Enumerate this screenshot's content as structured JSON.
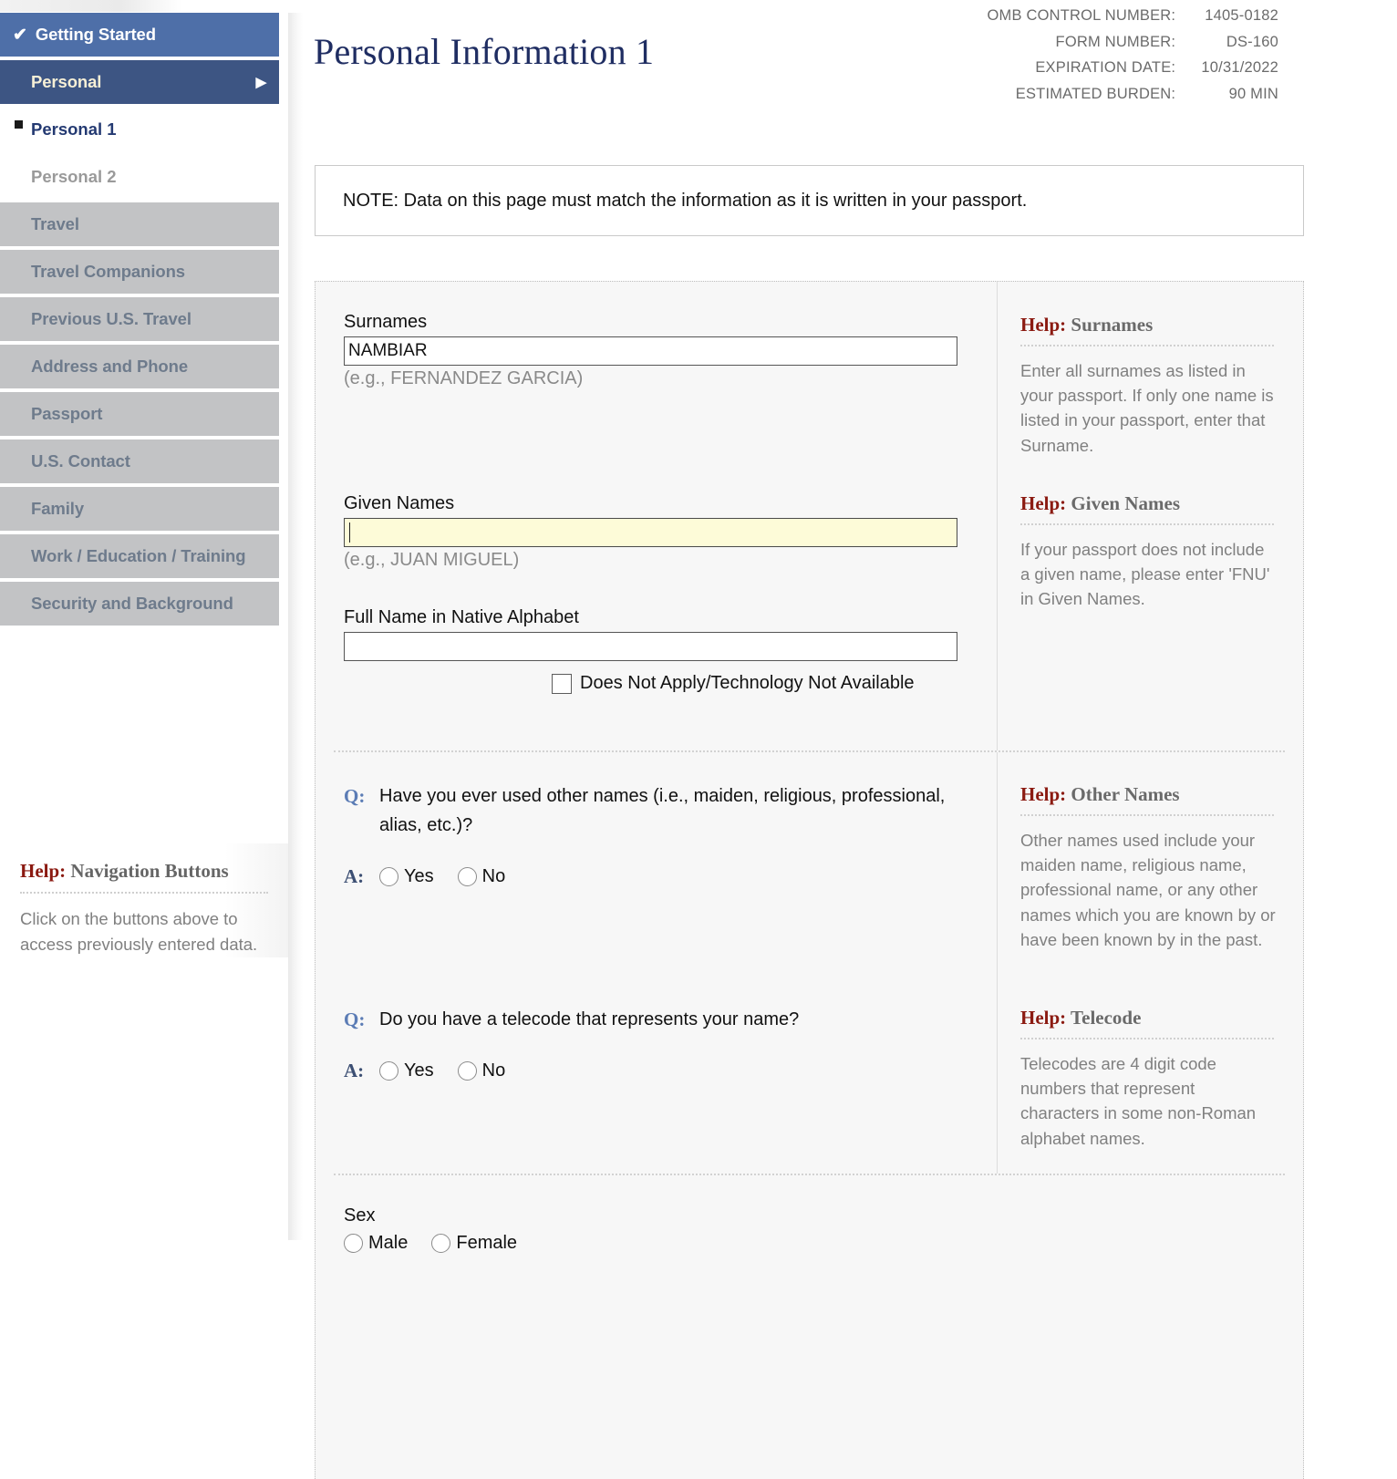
{
  "meta": {
    "rows": [
      {
        "label": "OMB CONTROL NUMBER:",
        "value": "1405-0182"
      },
      {
        "label": "FORM NUMBER:",
        "value": "DS-160"
      },
      {
        "label": "EXPIRATION DATE:",
        "value": "10/31/2022"
      },
      {
        "label": "ESTIMATED BURDEN:",
        "value": "90 MIN"
      }
    ]
  },
  "sidebar": {
    "items": [
      {
        "label": "Getting Started",
        "state": "done",
        "icon": "check-icon"
      },
      {
        "label": "Personal",
        "state": "current",
        "icon": "arrow-right-icon"
      },
      {
        "label": "Personal 1",
        "state": "sub-active",
        "icon": "square-bullet-icon"
      },
      {
        "label": "Personal 2",
        "state": "sub"
      },
      {
        "label": "Travel",
        "state": "normal"
      },
      {
        "label": "Travel Companions",
        "state": "normal"
      },
      {
        "label": "Previous U.S. Travel",
        "state": "normal"
      },
      {
        "label": "Address and Phone",
        "state": "normal"
      },
      {
        "label": "Passport",
        "state": "normal"
      },
      {
        "label": "U.S. Contact",
        "state": "normal"
      },
      {
        "label": "Family",
        "state": "normal"
      },
      {
        "label": "Work / Education / Training",
        "state": "normal"
      },
      {
        "label": "Security and Background",
        "state": "normal"
      }
    ],
    "help": {
      "word": "Help:",
      "title": "Navigation Buttons",
      "body": "Click on the buttons above to access previously entered data."
    }
  },
  "page": {
    "title": "Personal Information 1",
    "note": "NOTE: Data on this page must match the information as it is written in your passport."
  },
  "form": {
    "surnames": {
      "label": "Surnames",
      "value": "NAMBIAR",
      "hint": "(e.g., FERNANDEZ GARCIA)"
    },
    "given_names": {
      "label": "Given Names",
      "value": "",
      "hint": "(e.g., JUAN MIGUEL)"
    },
    "native_alphabet": {
      "label": "Full Name in Native Alphabet",
      "value": "",
      "checkbox_label": "Does Not Apply/Technology Not Available",
      "checked": false
    },
    "other_names": {
      "q_marker": "Q:",
      "a_marker": "A:",
      "question": "Have you ever used other names (i.e., maiden, religious, professional, alias, etc.)?",
      "options": [
        "Yes",
        "No"
      ],
      "selected": ""
    },
    "telecode": {
      "q_marker": "Q:",
      "a_marker": "A:",
      "question": "Do you have a telecode that represents your name?",
      "options": [
        "Yes",
        "No"
      ],
      "selected": ""
    },
    "sex": {
      "label": "Sex",
      "options": [
        "Male",
        "Female"
      ],
      "selected": ""
    }
  },
  "help_panels": {
    "word": "Help:",
    "surnames": {
      "title": "Surnames",
      "body": "Enter all surnames as listed in your passport. If only one name is listed in your passport, enter that Surname."
    },
    "given_names": {
      "title": "Given Names",
      "body": "If your passport does not include a given name, please enter 'FNU' in Given Names."
    },
    "other_names": {
      "title": "Other Names",
      "body": "Other names used include your maiden name, religious name, professional name, or any other names which you are known by or have been known by in the past."
    },
    "telecode": {
      "title": "Telecode",
      "body": "Telecodes are 4 digit code numbers that represent characters in some non-Roman alphabet names."
    }
  },
  "colors": {
    "nav_done": "#4e6fa8",
    "nav_current": "#3d5583",
    "nav_normal": "#c2c3c5",
    "title_blue": "#1f2d62",
    "help_red": "#8b1a11",
    "focus_yellow": "#fdfbd8"
  }
}
